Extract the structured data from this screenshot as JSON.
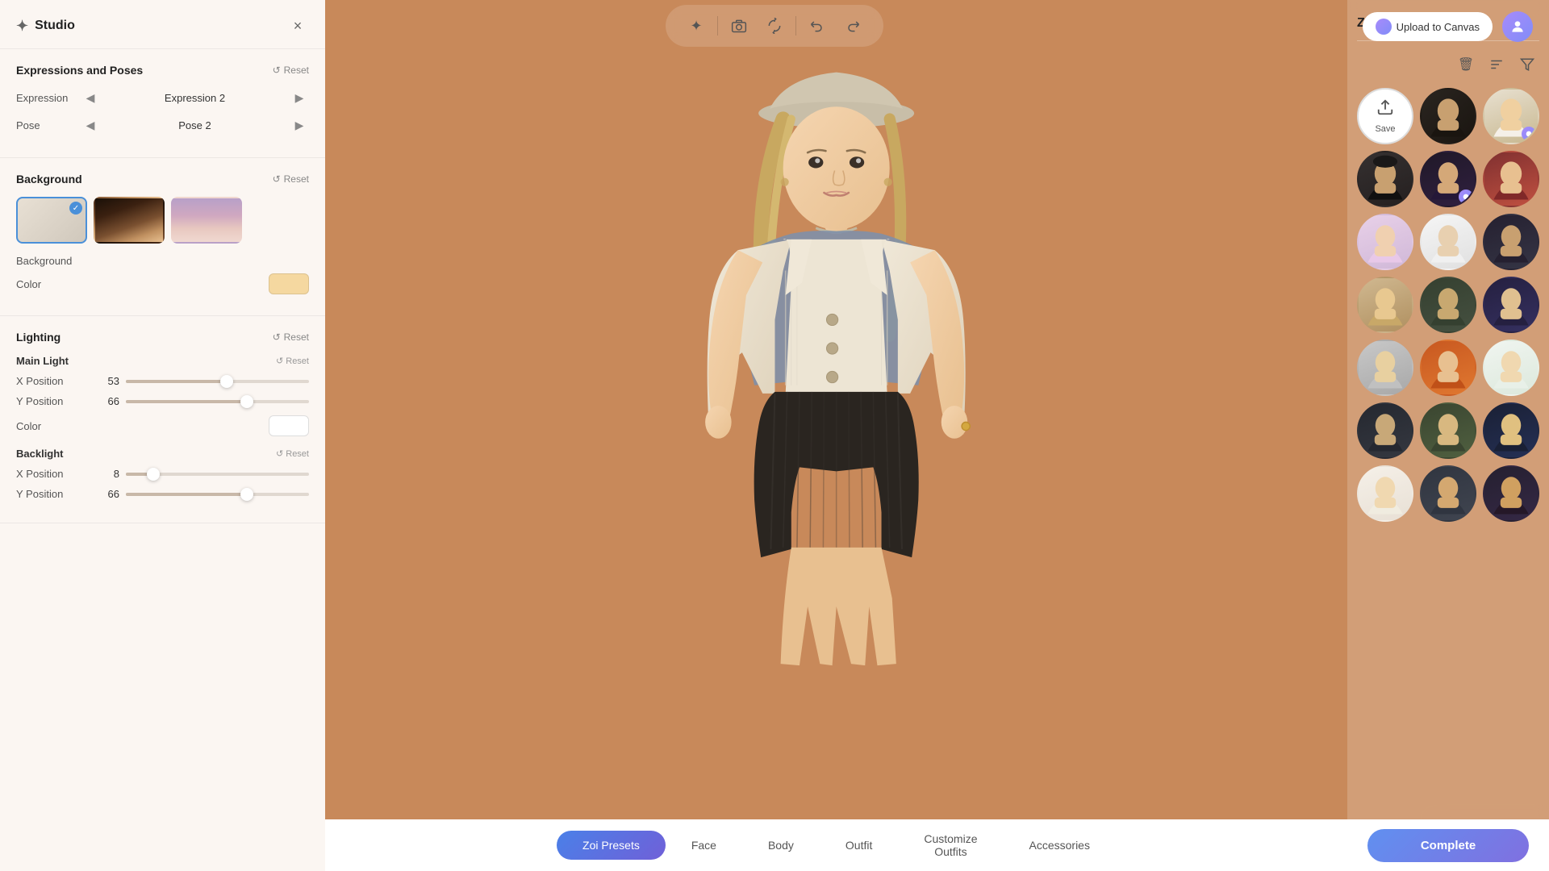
{
  "app": {
    "title": "Studio",
    "title_icon": "✦"
  },
  "toolbar": {
    "tools": [
      {
        "name": "sparkle-tool",
        "icon": "✦",
        "label": "Sparkle Tool"
      },
      {
        "name": "camera-tool",
        "icon": "📷",
        "label": "Camera"
      },
      {
        "name": "rotate-tool",
        "icon": "↻",
        "label": "Rotate"
      },
      {
        "name": "undo-tool",
        "icon": "↩",
        "label": "Undo"
      },
      {
        "name": "redo-tool",
        "icon": "↪",
        "label": "Redo"
      }
    ],
    "upload_label": "Upload to Canvas",
    "close_label": "×"
  },
  "panels": {
    "left": {
      "sections": {
        "expressions_poses": {
          "title": "Expressions and Poses",
          "reset_label": "Reset",
          "expression_label": "Expression",
          "expression_value": "Expression 2",
          "pose_label": "Pose",
          "pose_value": "Pose 2"
        },
        "background": {
          "title": "Background",
          "reset_label": "Reset",
          "bg_label": "Background",
          "color_label": "Color",
          "color_value": "#f5d8a0",
          "thumbnails": [
            {
              "id": "thumb-1",
              "type": "plain",
              "selected": true
            },
            {
              "id": "thumb-2",
              "type": "room"
            },
            {
              "id": "thumb-3",
              "type": "sky"
            }
          ]
        },
        "lighting": {
          "title": "Lighting",
          "reset_label": "Reset",
          "main_light": {
            "title": "Main Light",
            "reset_label": "Reset",
            "x_label": "X Position",
            "x_value": 53,
            "x_percent": 55,
            "y_label": "Y Position",
            "y_value": 66,
            "y_percent": 66,
            "color_label": "Color",
            "color_value": "#ffffff"
          },
          "backlight": {
            "title": "Backlight",
            "reset_label": "Reset",
            "x_label": "X Position",
            "x_value": 8,
            "x_percent": 15,
            "y_label": "Y Position",
            "y_value": 66,
            "y_percent": 66
          }
        }
      }
    },
    "right": {
      "title": "Zoi Presets",
      "presets": [
        {
          "id": "save",
          "type": "save",
          "save_icon": "⬆",
          "save_label": "Save"
        },
        {
          "id": "p1",
          "type": "avatar",
          "class": "p1",
          "has_badge": false
        },
        {
          "id": "p2",
          "type": "avatar",
          "class": "p2",
          "has_badge": true
        },
        {
          "id": "p3",
          "type": "avatar",
          "class": "p3",
          "has_badge": false
        },
        {
          "id": "p4",
          "type": "avatar",
          "class": "p4",
          "has_badge": true
        },
        {
          "id": "p5",
          "type": "avatar",
          "class": "p5",
          "has_badge": false
        },
        {
          "id": "p6",
          "type": "avatar",
          "class": "p6",
          "has_badge": false
        },
        {
          "id": "p7",
          "type": "avatar",
          "class": "p7",
          "has_badge": false
        },
        {
          "id": "p8",
          "type": "avatar",
          "class": "p8",
          "has_badge": false
        },
        {
          "id": "p9",
          "type": "avatar",
          "class": "p9",
          "has_badge": false
        },
        {
          "id": "p10",
          "type": "avatar",
          "class": "p10",
          "has_badge": false
        },
        {
          "id": "p11",
          "type": "avatar",
          "class": "p11",
          "has_badge": false
        },
        {
          "id": "p12",
          "type": "avatar",
          "class": "p12",
          "has_badge": false
        },
        {
          "id": "p13",
          "type": "avatar",
          "class": "p13",
          "has_badge": false
        },
        {
          "id": "p14",
          "type": "avatar",
          "class": "p14",
          "has_badge": false
        },
        {
          "id": "p15",
          "type": "avatar",
          "class": "p15",
          "has_badge": false
        },
        {
          "id": "p16",
          "type": "avatar",
          "class": "p16",
          "has_badge": false
        },
        {
          "id": "p17",
          "type": "avatar",
          "class": "p17",
          "has_badge": false
        },
        {
          "id": "p18",
          "type": "avatar",
          "class": "p18",
          "has_badge": false
        },
        {
          "id": "p19",
          "type": "avatar",
          "class": "p19",
          "has_badge": false
        },
        {
          "id": "p20",
          "type": "avatar",
          "class": "p20",
          "has_badge": false
        },
        {
          "id": "p21",
          "type": "avatar",
          "class": "p21",
          "has_badge": false
        }
      ]
    }
  },
  "bottom_nav": {
    "tabs": [
      {
        "id": "zoi-presets",
        "label": "Zoi Presets",
        "active": true
      },
      {
        "id": "face",
        "label": "Face"
      },
      {
        "id": "body",
        "label": "Body"
      },
      {
        "id": "outfit",
        "label": "Outfit"
      },
      {
        "id": "customize-outfits",
        "label": "Customize Outfits"
      },
      {
        "id": "accessories",
        "label": "Accessories"
      }
    ],
    "complete_label": "Complete"
  }
}
